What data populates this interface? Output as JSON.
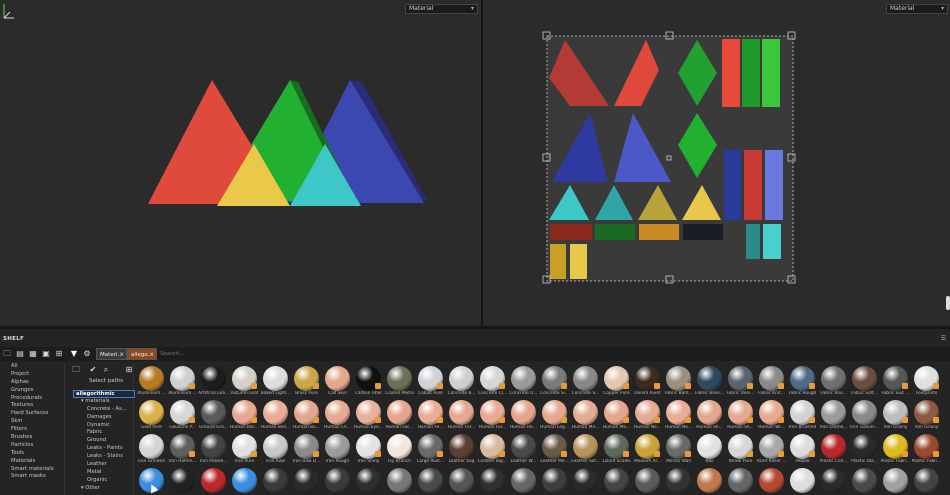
{
  "viewport3d": {
    "display_select": "Material"
  },
  "viewport2d": {
    "display_select": "Material"
  },
  "shelf": {
    "title": "SHELF",
    "menu_glyph": "☰",
    "tabs": [
      {
        "label": "Materi..."
      },
      {
        "label": "allego..."
      }
    ],
    "tab_close_glyph": "✕",
    "search_placeholder": "Search...",
    "categories": [
      "All",
      "Project",
      "Alphas",
      "Grunges",
      "Procedurals",
      "Textures",
      "Hard Surfaces",
      "Skin",
      "Filters",
      "Brushes",
      "Particles",
      "Tools",
      "Materials",
      "Smart materials",
      "Smart masks"
    ],
    "select_paths_label": "Select paths",
    "tree": [
      {
        "label": "allegorithmic",
        "level": 0
      },
      {
        "label": "materials",
        "level": 1
      },
      {
        "label": "Concrete - As...",
        "level": 2
      },
      {
        "label": "Damages",
        "level": 2
      },
      {
        "label": "Dynamic",
        "level": 2
      },
      {
        "label": "Fabric",
        "level": 2
      },
      {
        "label": "Ground",
        "level": 2
      },
      {
        "label": "Leaks - Paints",
        "level": 2
      },
      {
        "label": "Leaks - Stains",
        "level": 2
      },
      {
        "label": "Leather",
        "level": 2
      },
      {
        "label": "Metal",
        "level": 2
      },
      {
        "label": "Organic",
        "level": 2
      },
      {
        "label": "Other",
        "level": 1
      }
    ],
    "toolbar_icons": [
      "folder-icon",
      "new-file-icon",
      "import-icon",
      "save-icon",
      "grid-icon",
      "filter-icon",
      "settings-icon"
    ],
    "tree_tool_icons": [
      "folder-icon",
      "check-icon",
      "search-icon",
      "add-icon"
    ],
    "materials": [
      [
        {
          "label": "Aluminium ...",
          "color": "#b57c24"
        },
        {
          "label": "Aluminium ...",
          "color": "#cfcfcf"
        },
        {
          "label": "Artificial Lea...",
          "color": "#1c1c1c"
        },
        {
          "label": "Autumn Leaf",
          "color": "#d3d0c8"
        },
        {
          "label": "Baked Light...",
          "color": "#dcdcdc"
        },
        {
          "label": "Brass Pure",
          "color": "#c9a646"
        },
        {
          "label": "Calf Skin",
          "color": "#e2a88c"
        },
        {
          "label": "Carbon Fiber",
          "color": "#111111"
        },
        {
          "label": "Coated Metal",
          "color": "#6e6e58"
        },
        {
          "label": "Cobalt Pure",
          "color": "#cfd3d8"
        },
        {
          "label": "Concrete B...",
          "color": "#cfcfcf"
        },
        {
          "label": "Concrete Cl...",
          "color": "#d6d6d6"
        },
        {
          "label": "Concrete D...",
          "color": "#9a9a9a"
        },
        {
          "label": "Concrete Si...",
          "color": "#7a7a7a"
        },
        {
          "label": "Concrete S...",
          "color": "#888888"
        },
        {
          "label": "Copper Pure",
          "color": "#e3c6b0"
        },
        {
          "label": "Denim Rivet",
          "color": "#3a2a20"
        },
        {
          "label": "Fabric Bam...",
          "color": "#9b8f80"
        },
        {
          "label": "Fabric Base...",
          "color": "#2f4a5e"
        },
        {
          "label": "Fabric Deni...",
          "color": "#5a6470"
        },
        {
          "label": "Fabric Knit...",
          "color": "#8a8a8a"
        },
        {
          "label": "Fabric Rough",
          "color": "#4e6a85"
        },
        {
          "label": "Fabric Rou...",
          "color": "#707070"
        },
        {
          "label": "Fabric Soft...",
          "color": "#6a4e42"
        },
        {
          "label": "Fabric Suit ...",
          "color": "#575757"
        },
        {
          "label": "Footprints",
          "color": "#e0e0e0"
        }
      ],
      [
        {
          "label": "Gold Pure",
          "color": "#d9b24a"
        },
        {
          "label": "Gouache P...",
          "color": "#d6d6d6"
        },
        {
          "label": "Ground Gra...",
          "color": "#5a5a5a"
        },
        {
          "label": "Human Bac...",
          "color": "#e6a88f"
        },
        {
          "label": "Human Bell...",
          "color": "#e8ad94"
        },
        {
          "label": "Human Bu...",
          "color": "#e3a78e"
        },
        {
          "label": "Human Ch...",
          "color": "#e6aa92"
        },
        {
          "label": "Human Eye...",
          "color": "#e9b09a"
        },
        {
          "label": "Human Fac...",
          "color": "#e4a68c"
        },
        {
          "label": "Human Fe...",
          "color": "#e9ad96"
        },
        {
          "label": "Human For...",
          "color": "#e6a98f"
        },
        {
          "label": "Human For...",
          "color": "#e7ab91"
        },
        {
          "label": "Human He...",
          "color": "#e4a68d"
        },
        {
          "label": "Human Leg...",
          "color": "#e6a990"
        },
        {
          "label": "Human Mo...",
          "color": "#e7ab93"
        },
        {
          "label": "Human Mo...",
          "color": "#e3a58c"
        },
        {
          "label": "Human Ne...",
          "color": "#e6aa91"
        },
        {
          "label": "Human No...",
          "color": "#e8ac94"
        },
        {
          "label": "Human Sh...",
          "color": "#e5a88f"
        },
        {
          "label": "Human Sh...",
          "color": "#e6a990"
        },
        {
          "label": "Human Wr...",
          "color": "#e7ab92"
        },
        {
          "label": "Iron Brushed",
          "color": "#d2d2d2"
        },
        {
          "label": "Iron Diamo...",
          "color": "#9a9a9a"
        },
        {
          "label": "Iron Galvan...",
          "color": "#8a8a8a"
        },
        {
          "label": "Iron Grainy",
          "color": "#bdbdbd"
        },
        {
          "label": "Iron Grainy",
          "color": "#8c5a40"
        }
      ],
      [
        {
          "label": "Iron Grinded",
          "color": "#d4d4d4"
        },
        {
          "label": "Iron Hamm...",
          "color": "#5e5e5e"
        },
        {
          "label": "Iron Powde...",
          "color": "#444444"
        },
        {
          "label": "Iron Pure",
          "color": "#e0e0e0"
        },
        {
          "label": "Iron Raw",
          "color": "#c8c8c8"
        },
        {
          "label": "Iron Raw D...",
          "color": "#8a8a8a"
        },
        {
          "label": "Iron Rough",
          "color": "#9c9c9c"
        },
        {
          "label": "Iron Shiny",
          "color": "#e3e3e3"
        },
        {
          "label": "Ivy Branch",
          "color": "#f2e6dc"
        },
        {
          "label": "Large Rust...",
          "color": "#6a6a6a"
        },
        {
          "label": "Leather bag",
          "color": "#5c3f34"
        },
        {
          "label": "Leather Big...",
          "color": "#d9b9a0"
        },
        {
          "label": "Leather W...",
          "color": "#4a4a4a"
        },
        {
          "label": "Leather Me...",
          "color": "#6a5a48"
        },
        {
          "label": "Leather Sof...",
          "color": "#b9935c"
        },
        {
          "label": "Lizard Scales",
          "color": "#5c6a5a"
        },
        {
          "label": "Medium Ar...",
          "color": "#c9a23a"
        },
        {
          "label": "Mortar Wall",
          "color": "#6a6a6a"
        },
        {
          "label": "Nail",
          "color": "#e1e1e1"
        },
        {
          "label": "Nickel Pure",
          "color": "#d6d6d6"
        },
        {
          "label": "Paint Roller ...",
          "color": "#a7a7a7"
        },
        {
          "label": "Pebble",
          "color": "#dcdcdc"
        },
        {
          "label": "Plastic Cell...",
          "color": "#b82a2a"
        },
        {
          "label": "Plastic Dia...",
          "color": "#2a2a2a"
        },
        {
          "label": "Plastic Fabri...",
          "color": "#e0b820"
        },
        {
          "label": "Plastic Fabri...",
          "color": "#9a4a30"
        }
      ],
      [
        {
          "label": "",
          "color": "#3a8ee0"
        },
        {
          "label": "",
          "color": "#222222"
        },
        {
          "label": "",
          "color": "#b82a2a"
        },
        {
          "label": "",
          "color": "#3a8ee0"
        },
        {
          "label": "",
          "color": "#3a3a3a"
        },
        {
          "label": "",
          "color": "#2a2a2a"
        },
        {
          "label": "",
          "color": "#3a3a3a"
        },
        {
          "label": "",
          "color": "#2e2e2e"
        },
        {
          "label": "",
          "color": "#777777"
        },
        {
          "label": "",
          "color": "#4a4a4a"
        },
        {
          "label": "",
          "color": "#555555"
        },
        {
          "label": "",
          "color": "#303030"
        },
        {
          "label": "",
          "color": "#666666"
        },
        {
          "label": "",
          "color": "#3e3e3e"
        },
        {
          "label": "",
          "color": "#2a2a2a"
        },
        {
          "label": "",
          "color": "#444444"
        },
        {
          "label": "",
          "color": "#5a5a5a"
        },
        {
          "label": "",
          "color": "#333333"
        },
        {
          "label": "",
          "color": "#c07a4a"
        },
        {
          "label": "",
          "color": "#666666"
        },
        {
          "label": "",
          "color": "#b24a30"
        },
        {
          "label": "",
          "color": "#dddddd"
        },
        {
          "label": "",
          "color": "#2a2a2a"
        },
        {
          "label": "",
          "color": "#4a4a4a"
        },
        {
          "label": "",
          "color": "#a0a0a0"
        },
        {
          "label": "",
          "color": "#444444"
        }
      ]
    ],
    "badge_columns": [
      1,
      3,
      5,
      7,
      9,
      11,
      13,
      15,
      16,
      17,
      19,
      20,
      21,
      24,
      25
    ]
  }
}
